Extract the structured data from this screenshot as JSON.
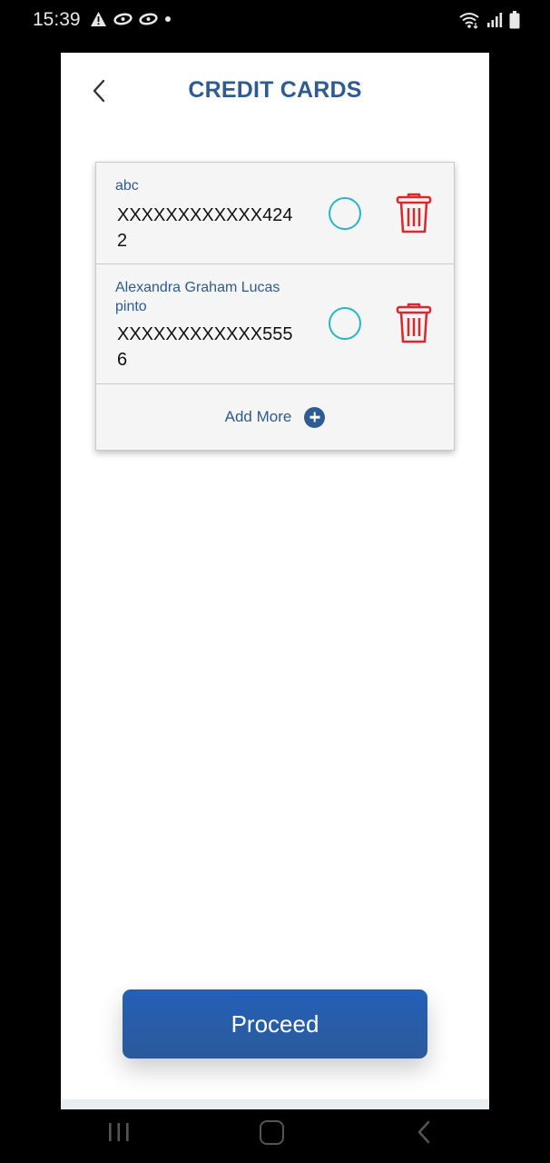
{
  "status_bar": {
    "time": "15:39"
  },
  "header": {
    "title": "CREDIT CARDS"
  },
  "cards": [
    {
      "name": "abc",
      "number": "XXXXXXXXXXXX4242"
    },
    {
      "name": "Alexandra Graham Lucas pinto",
      "number": "XXXXXXXXXXXX5556"
    }
  ],
  "add_more": {
    "label": "Add More"
  },
  "proceed": {
    "label": "Proceed"
  },
  "colors": {
    "accent": "#2d5b92",
    "radio": "#27b6c6",
    "delete": "#e0262a",
    "button": "#2460b8"
  },
  "icons": [
    "back-arrow-icon",
    "radio-circle-icon",
    "trash-icon",
    "plus-circle-icon"
  ]
}
